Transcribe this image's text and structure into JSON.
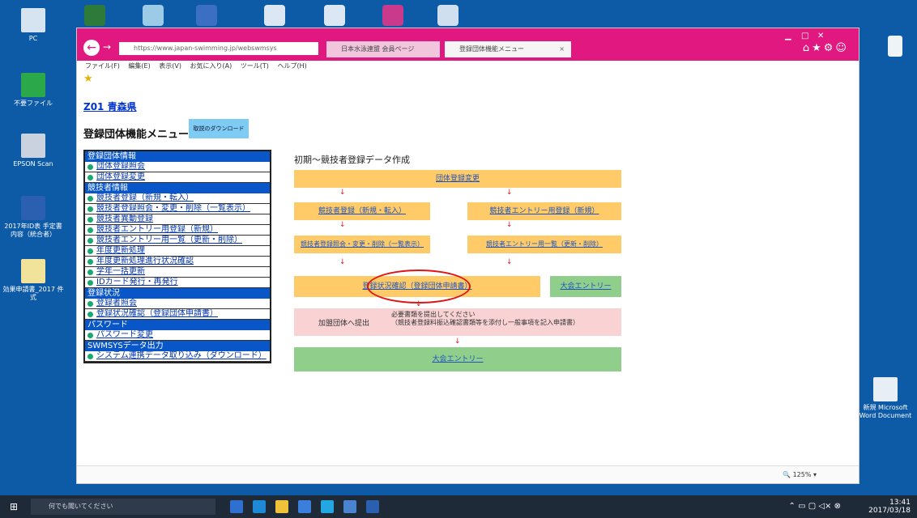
{
  "desktop": {
    "icons": [
      {
        "label": "PC"
      },
      {
        "label": "不要ファイル"
      },
      {
        "label": "EPSON Scan"
      },
      {
        "label": "2017年ID表 手定書内容（統合者）"
      },
      {
        "label": "効果申請書_2017 件式"
      },
      {
        "label": "新規 Microsoft Word Document"
      }
    ]
  },
  "browser": {
    "address": "https://www.japan-swimming.jp/webswmsys",
    "tabs": [
      {
        "label": "日本水泳連盟 会員ページ"
      },
      {
        "label": "登録団体機能メニュー"
      }
    ],
    "close_tab": "×",
    "menu": [
      "ファイル(F)",
      "編集(E)",
      "表示(V)",
      "お気に入り(A)",
      "ツール(T)",
      "ヘルプ(H)"
    ],
    "zoom": "125%"
  },
  "page": {
    "org_link": "Z01 青森県",
    "menu_title": "登録団体機能メニュー",
    "download_button": "取説のダウンロード",
    "sidebar": [
      {
        "type": "head",
        "label": "登録団体情報"
      },
      {
        "type": "item",
        "label": "団体登録照会"
      },
      {
        "type": "item",
        "label": "団体登録変更"
      },
      {
        "type": "head",
        "label": "競技者情報"
      },
      {
        "type": "item",
        "label": "競技者登録（新規・転入）"
      },
      {
        "type": "item",
        "label": "競技者登録照会・変更・削除（一覧表示）"
      },
      {
        "type": "item",
        "label": "競技者異動登録"
      },
      {
        "type": "item",
        "label": "競技者エントリー用登録（新規）"
      },
      {
        "type": "item",
        "label": "競技者エントリー用一覧（更新・削除）"
      },
      {
        "type": "item",
        "label": "年度更新処理"
      },
      {
        "type": "item",
        "label": "年度更新処理進行状況確認"
      },
      {
        "type": "item",
        "label": "学年一括更新"
      },
      {
        "type": "item",
        "label": "IDカード発行・再発行"
      },
      {
        "type": "head",
        "label": "登録状況"
      },
      {
        "type": "item",
        "label": "登録者照会"
      },
      {
        "type": "item",
        "label": "登録状況確認（登録団体申請書）"
      },
      {
        "type": "head",
        "label": "パスワード"
      },
      {
        "type": "item",
        "label": "パスワード変更"
      },
      {
        "type": "head",
        "label": "SWMSYSデータ出力"
      },
      {
        "type": "item",
        "label": "システム連携データ取り込み（ダウンロード）"
      }
    ],
    "flow": {
      "title": "初期～競技者登録データ作成",
      "team_register": "団体登録変更",
      "athlete_register": "競技者登録（新規・転入）",
      "entry_register": "競技者エントリー用登録（新規）",
      "athlete_list": "競技者登録照会・変更・削除（一覧表示）",
      "entry_list": "競技者エントリー用一覧（更新・削除）",
      "apply_form": "登録状況確認（登録団体申請書）",
      "entry_btn": "大会エントリー",
      "submit_label": "加盟団体へ提出",
      "submit_note": "必要書類を提出してください\n（競技者登録料振込確認書類等を添付し一般事項を記入申請書）",
      "final_entry": "大会エントリー"
    }
  },
  "taskbar": {
    "search_placeholder": "何でも聞いてください",
    "time": "13:41",
    "date": "2017/03/18"
  }
}
